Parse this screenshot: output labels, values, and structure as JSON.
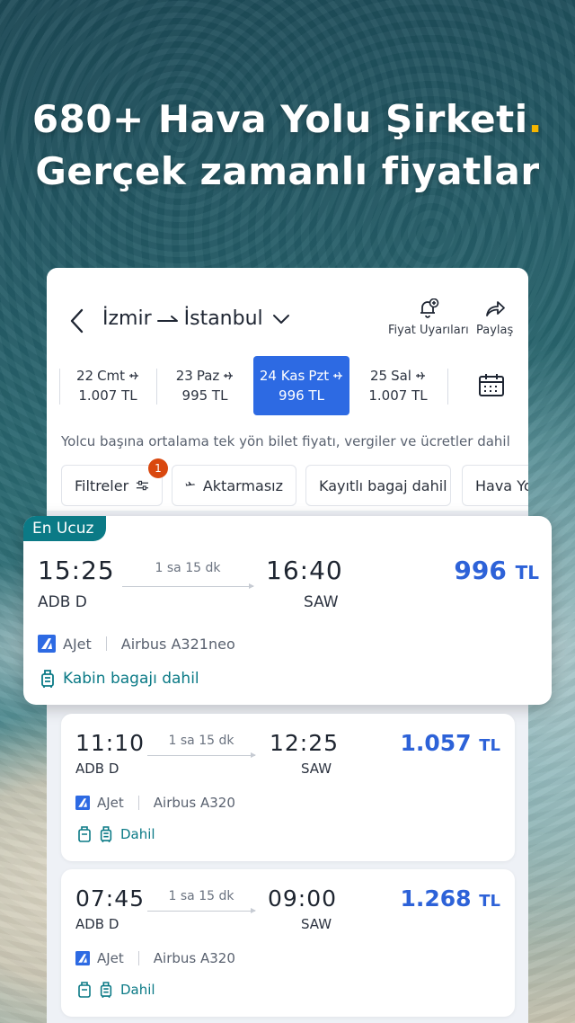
{
  "hero": {
    "line1": "680+ Hava Yolu Şirketi",
    "dot": ".",
    "line2": "Gerçek zamanlı fiyatlar"
  },
  "header": {
    "origin": "İzmir",
    "destination": "İstanbul",
    "price_alerts_label": "Fiyat Uyarıları",
    "share_label": "Paylaş"
  },
  "dates": [
    {
      "day": "22",
      "weekday": "Cmt",
      "price": "1.007 TL",
      "selected": false
    },
    {
      "day": "23",
      "weekday": "Paz",
      "price": "995 TL",
      "selected": false
    },
    {
      "day": "24 Kas",
      "weekday": "Pzt",
      "price": "996 TL",
      "selected": true
    },
    {
      "day": "25",
      "weekday": "Sal",
      "price": "1.007 TL",
      "selected": false
    }
  ],
  "note": "Yolcu başına ortalama tek yön bilet fiyatı, vergiler ve ücretler dahil",
  "filters": {
    "filter_label": "Filtreler",
    "filter_badge": "1",
    "nonstop_label": "Aktarmasız",
    "baggage_label": "Kayıtlı bagaj dahil",
    "airline_label": "Hava Yo"
  },
  "flights": [
    {
      "tag": "En Ucuz",
      "depart": "15:25",
      "arrive": "16:40",
      "from": "ADB D",
      "to": "SAW",
      "duration": "1 sa 15 dk",
      "price": "996",
      "currency": "TL",
      "airline": "AJet",
      "aircraft": "Airbus A321neo",
      "baggage": "Kabin bagajı dahil"
    },
    {
      "depart": "11:10",
      "arrive": "12:25",
      "from": "ADB D",
      "to": "SAW",
      "duration": "1 sa 15 dk",
      "price": "1.057",
      "currency": "TL",
      "airline": "AJet",
      "aircraft": "Airbus A320",
      "baggage": "Dahil"
    },
    {
      "depart": "07:45",
      "arrive": "09:00",
      "from": "ADB D",
      "to": "SAW",
      "duration": "1 sa 15 dk",
      "price": "1.268",
      "currency": "TL",
      "airline": "AJet",
      "aircraft": "Airbus A320",
      "baggage": "Dahil"
    }
  ],
  "colors": {
    "accent_blue": "#2d6ae3",
    "teal": "#0b7a86",
    "hero_dot": "#f6b600",
    "price_blue": "#2d62d8"
  }
}
